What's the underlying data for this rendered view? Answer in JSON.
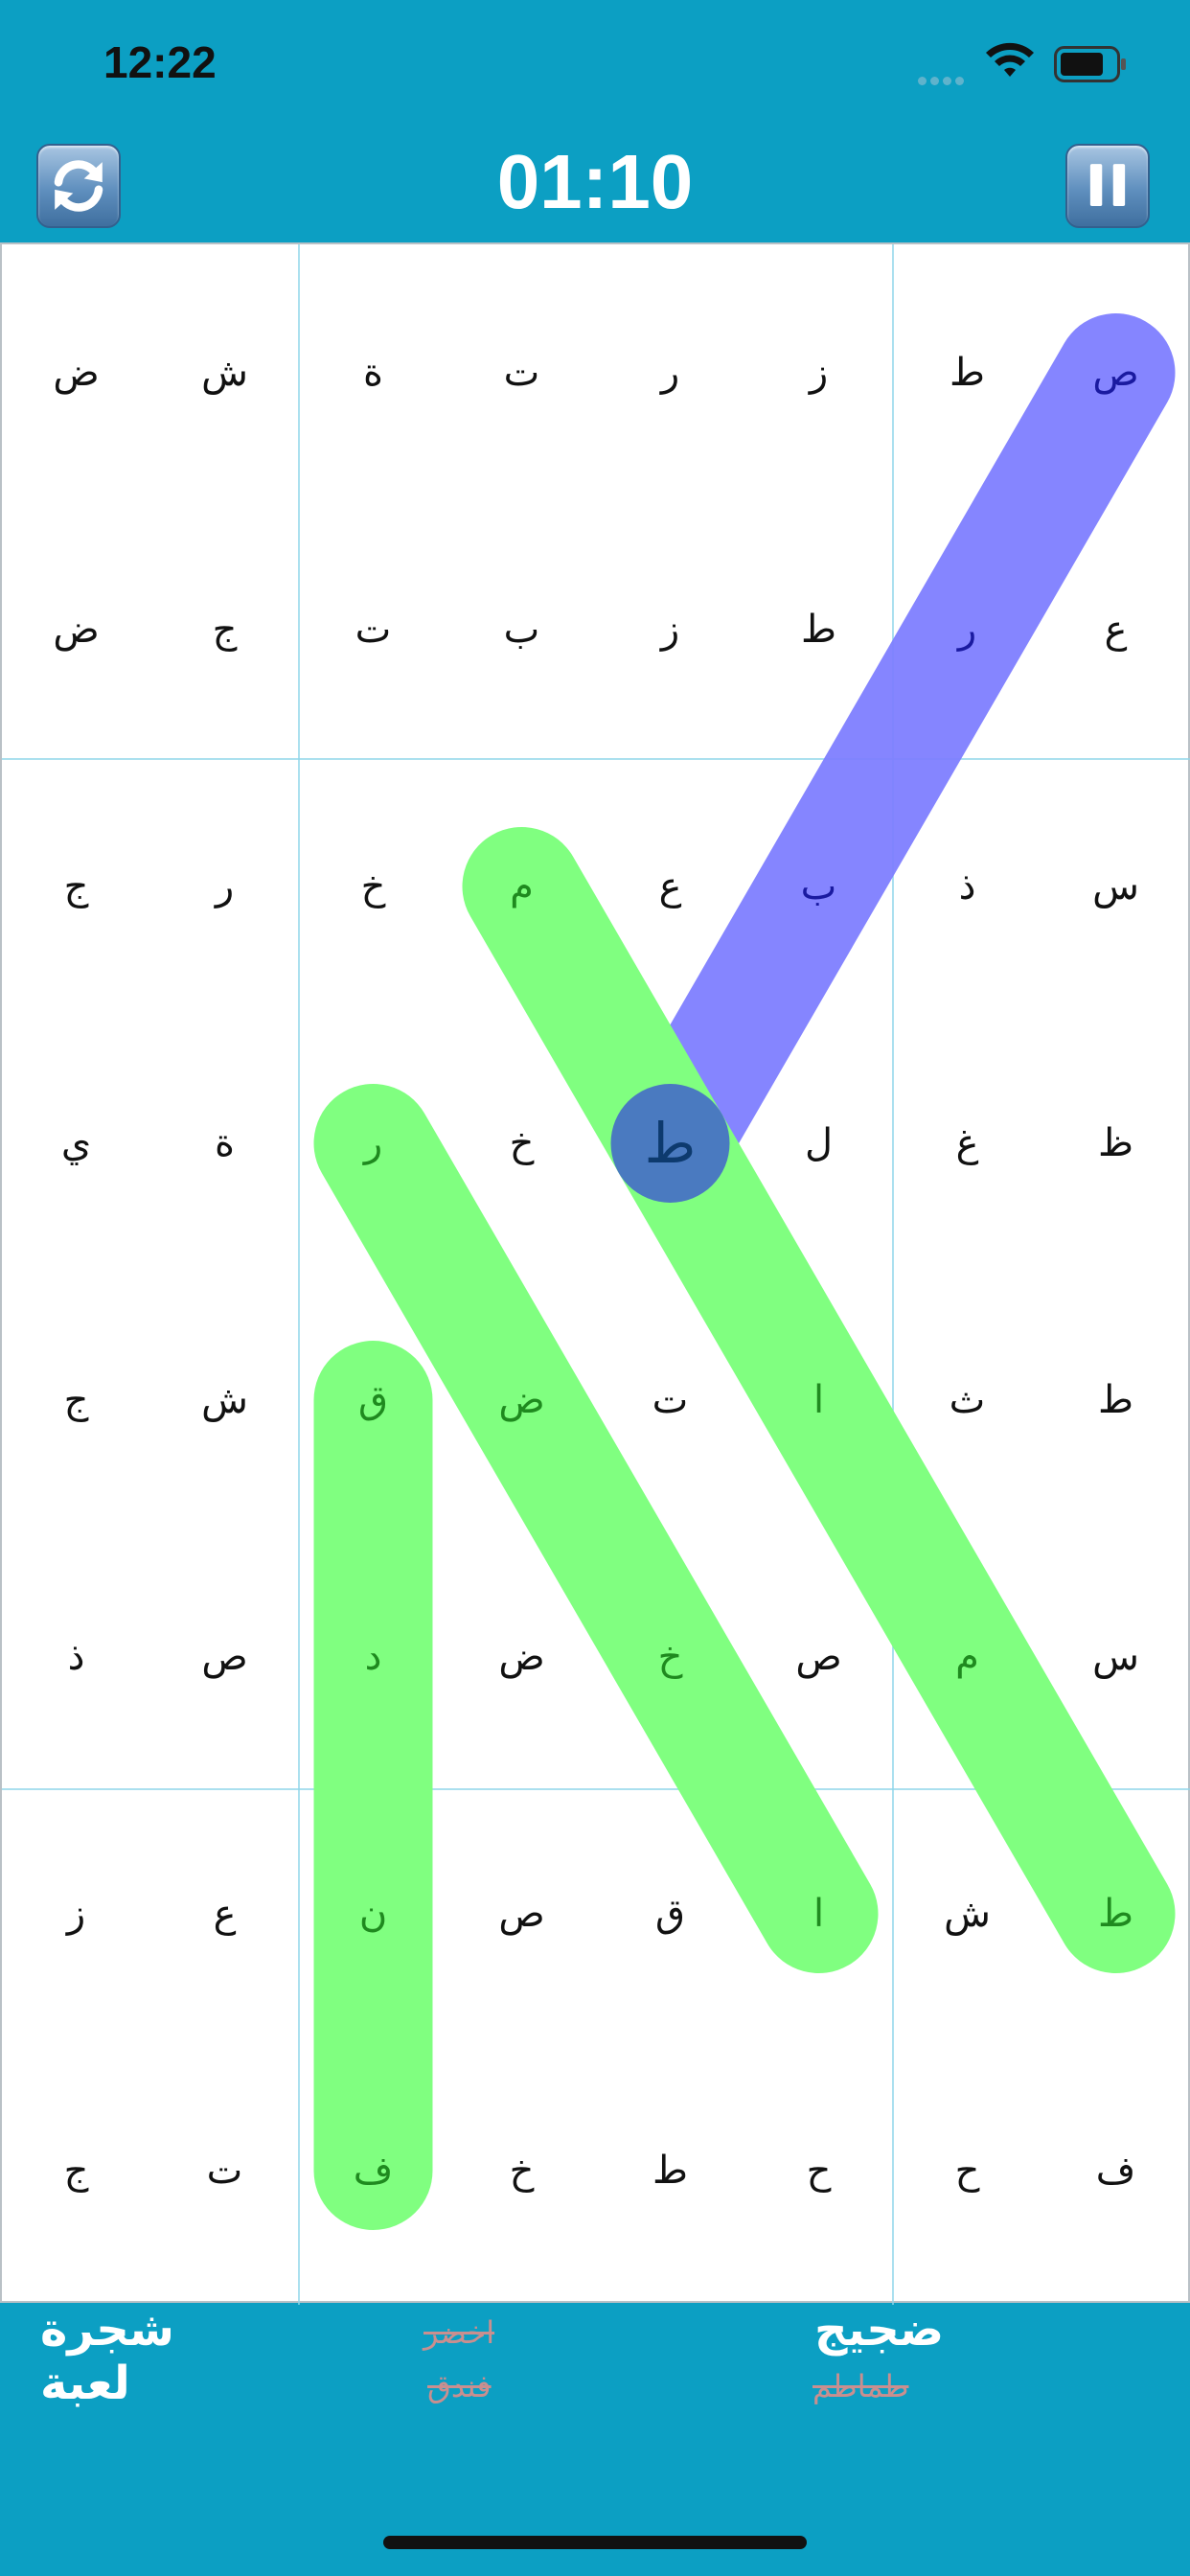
{
  "status_bar": {
    "time": "12:22"
  },
  "header": {
    "timer": "01:10"
  },
  "board": {
    "grid": [
      [
        "ض",
        "ش",
        "ة",
        "ت",
        "ر",
        "ز",
        "ط",
        "ص"
      ],
      [
        "ض",
        "ج",
        "ت",
        "ب",
        "ز",
        "ط",
        "ر",
        "ع"
      ],
      [
        "ج",
        "ر",
        "خ",
        "م",
        "ع",
        "ب",
        "ذ",
        "س"
      ],
      [
        "ي",
        "ة",
        "ر",
        "خ",
        "ط",
        "ل",
        "غ",
        "ظ"
      ],
      [
        "ج",
        "ش",
        "ق",
        "ض",
        "ت",
        "ا",
        "ث",
        "ط"
      ],
      [
        "ذ",
        "ص",
        "د",
        "ض",
        "خ",
        "ص",
        "م",
        "س"
      ],
      [
        "ز",
        "ع",
        "ن",
        "ص",
        "ق",
        "ا",
        "ش",
        "ط"
      ],
      [
        "ج",
        "ت",
        "ف",
        "خ",
        "ط",
        "ح",
        "ح",
        "ف"
      ]
    ],
    "highlights": [
      {
        "word": "ضجيج",
        "color": "#7f7fff",
        "text_color": "#1a1aa0",
        "cells": [
          [
            0,
            7
          ],
          [
            1,
            6
          ],
          [
            2,
            5
          ],
          [
            3,
            4
          ]
        ]
      },
      {
        "word": "طماطم",
        "color": "#80ff80",
        "text_color": "#1f8a1f",
        "cells": [
          [
            2,
            3
          ],
          [
            3,
            4
          ],
          [
            4,
            5
          ],
          [
            5,
            6
          ],
          [
            6,
            7
          ]
        ]
      },
      {
        "word": "اخضر",
        "color": "#80ff80",
        "text_color": "#1f8a1f",
        "cells": [
          [
            3,
            2
          ],
          [
            4,
            3
          ],
          [
            5,
            4
          ],
          [
            6,
            5
          ]
        ]
      },
      {
        "word": "فندق",
        "color": "#80ff80",
        "text_color": "#1f8a1f",
        "cells": [
          [
            4,
            2
          ],
          [
            5,
            2
          ],
          [
            6,
            2
          ],
          [
            7,
            2
          ]
        ]
      }
    ]
  },
  "words": [
    {
      "text": "شجرة",
      "found": false
    },
    {
      "text": "لعبة",
      "found": false
    },
    {
      "text": "اخضر",
      "found": true
    },
    {
      "text": "فندق",
      "found": true
    },
    {
      "text": "ضجيج",
      "found": false
    },
    {
      "text": "طماطم",
      "found": true
    }
  ],
  "icons": {
    "refresh": "refresh-icon",
    "pause": "pause-icon",
    "wifi": "wifi-icon",
    "battery": "battery-icon"
  }
}
